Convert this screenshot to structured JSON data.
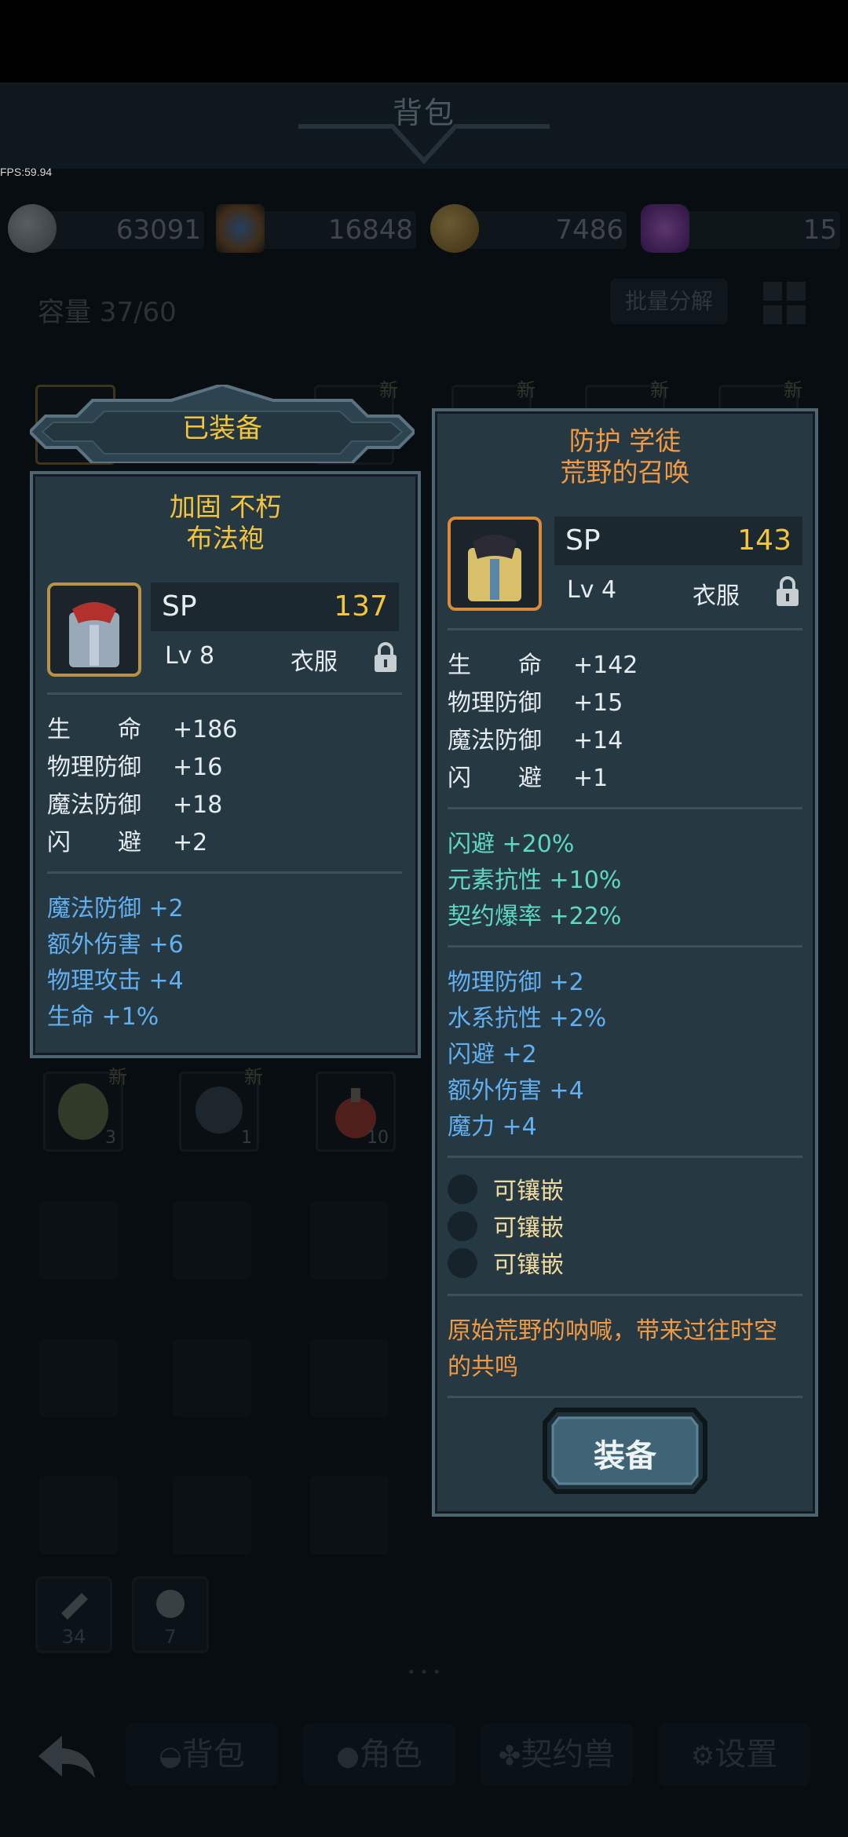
{
  "header": {
    "title": "背包",
    "fps": "FPS:59.94"
  },
  "currencies": [
    {
      "icon": "silver-coin-icon",
      "value": "63091"
    },
    {
      "icon": "crest-emblem-icon",
      "value": "16848"
    },
    {
      "icon": "gold-coin-icon",
      "value": "7486"
    },
    {
      "icon": "purple-gem-icon",
      "value": "15"
    }
  ],
  "inventory": {
    "capacity": "容量 37/60",
    "batch_button": "批量分解",
    "new_badge": "新",
    "row2_counts": [
      "3",
      "1",
      "10"
    ],
    "small_slots": [
      "34",
      "7"
    ]
  },
  "equipped_panel": {
    "tab_label": "已装备",
    "title_line1": "加固 不朽",
    "title_line2": "布法袍",
    "sp_label": "SP",
    "sp_value": "137",
    "level": "Lv 8",
    "type": "衣服",
    "stats": [
      {
        "key": "生　　命",
        "val": "+186"
      },
      {
        "key": "物理防御",
        "val": "+16"
      },
      {
        "key": "魔法防御",
        "val": "+18"
      },
      {
        "key": "闪　　避",
        "val": "+2"
      }
    ],
    "extras": [
      "魔法防御 +2",
      "额外伤害 +6",
      "物理攻击 +4",
      "生命 +1%"
    ]
  },
  "compare_panel": {
    "title_line1": "防护 学徒",
    "title_line2": "荒野的召唤",
    "sp_label": "SP",
    "sp_value": "143",
    "level": "Lv 4",
    "type": "衣服",
    "stats": [
      {
        "key": "生　　命",
        "val": "+142"
      },
      {
        "key": "物理防御",
        "val": "+15"
      },
      {
        "key": "魔法防御",
        "val": "+14"
      },
      {
        "key": "闪　　避",
        "val": "+1"
      }
    ],
    "special": [
      "闪避 +20%",
      "元素抗性 +10%",
      "契约爆率 +22%"
    ],
    "extras": [
      "物理防御 +2",
      "水系抗性 +2%",
      "闪避 +2",
      "额外伤害 +4",
      "魔力 +4"
    ],
    "sockets": [
      "可镶嵌",
      "可镶嵌",
      "可镶嵌"
    ],
    "description": [
      "原始荒野的呐喊，带来过往时空",
      "的共鸣"
    ],
    "equip_button": "装备"
  },
  "page_indicator": "• • •",
  "bottom_nav": [
    "背包",
    "角色",
    "契约兽",
    "设置"
  ],
  "colors": {
    "quality_yellow": "#f2c53d",
    "quality_orange": "#f09a46",
    "affix_blue": "#62b0f0",
    "special_teal": "#5fd8c2",
    "panel_bg": "#263842"
  }
}
